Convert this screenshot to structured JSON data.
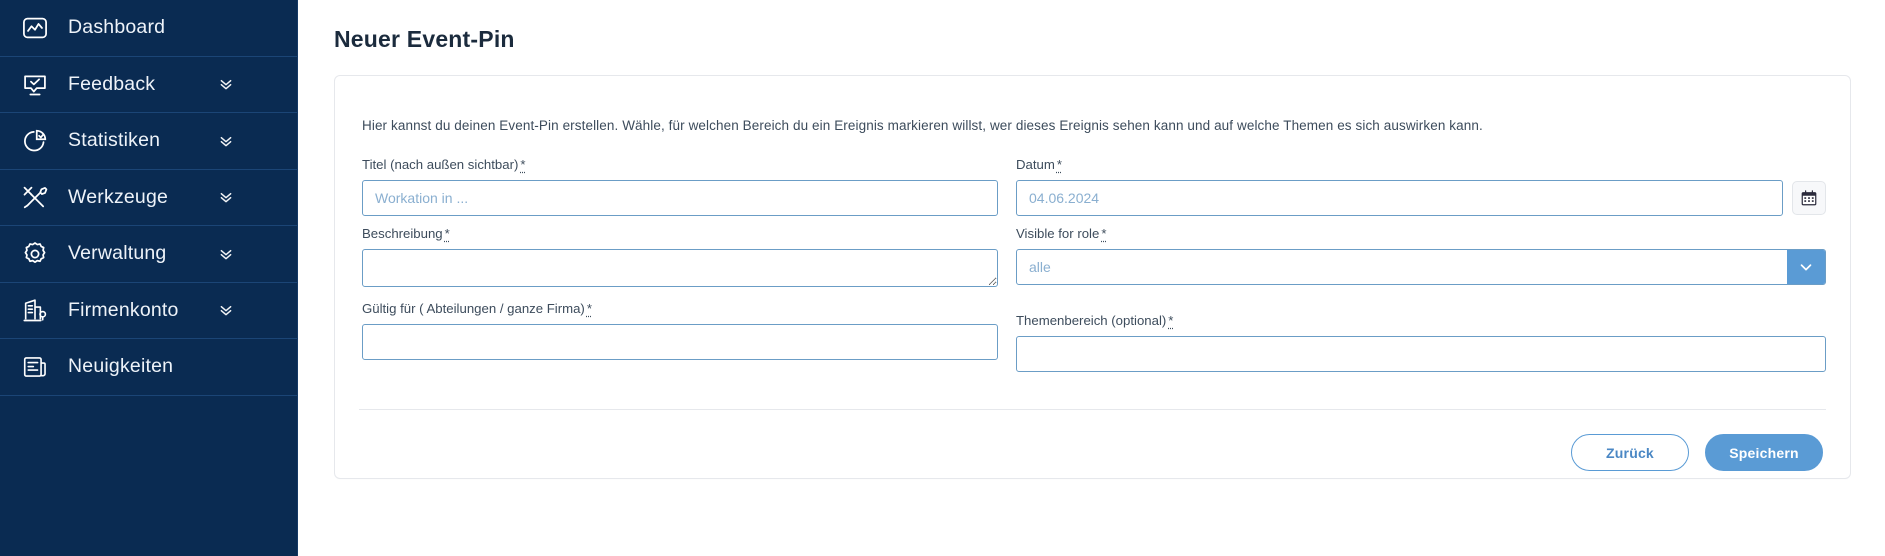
{
  "sidebar": {
    "items": [
      {
        "label": "Dashboard",
        "icon": "dashboard-chart-icon",
        "expandable": false
      },
      {
        "label": "Feedback",
        "icon": "feedback-speech-bubble-icon",
        "expandable": true
      },
      {
        "label": "Statistiken",
        "icon": "pie-chart-icon",
        "expandable": true
      },
      {
        "label": "Werkzeuge",
        "icon": "tools-wrench-screwdriver-icon",
        "expandable": true
      },
      {
        "label": "Verwaltung",
        "icon": "gear-icon",
        "expandable": true
      },
      {
        "label": "Firmenkonto",
        "icon": "company-building-icon",
        "expandable": true
      },
      {
        "label": "Neuigkeiten",
        "icon": "news-document-icon",
        "expandable": false
      }
    ],
    "chevron_icon": "chevron-double-down-icon",
    "background_color": "#0a2b52"
  },
  "page": {
    "title": "Neuer Event-Pin",
    "intro": "Hier kannst du deinen Event-Pin erstellen. Wähle, für welchen Bereich du ein Ereignis markieren willst, wer dieses Ereignis sehen kann und auf welche Themen es sich auswirken kann."
  },
  "form": {
    "required_marker": "*",
    "title": {
      "label": "Titel (nach außen sichtbar)",
      "placeholder": "Workation in ...",
      "value": ""
    },
    "date": {
      "label": "Datum",
      "placeholder": "04.06.2024",
      "value": "",
      "calendar_icon": "calendar-icon"
    },
    "description": {
      "label": "Beschreibung",
      "placeholder": "",
      "value": ""
    },
    "visible_for_role": {
      "label": "Visible for role",
      "placeholder": "alle",
      "value": "",
      "arrow_icon": "chevron-down-icon",
      "arrow_color": "#5a9bd5"
    },
    "valid_for": {
      "label": "Gültig für ( Abteilungen / ganze Firma)",
      "placeholder": "",
      "value": ""
    },
    "topic_area": {
      "label": "Themenbereich (optional)",
      "placeholder": "",
      "value": ""
    }
  },
  "actions": {
    "back_label": "Zurück",
    "save_label": "Speichern",
    "primary_color": "#5a9bd5"
  }
}
